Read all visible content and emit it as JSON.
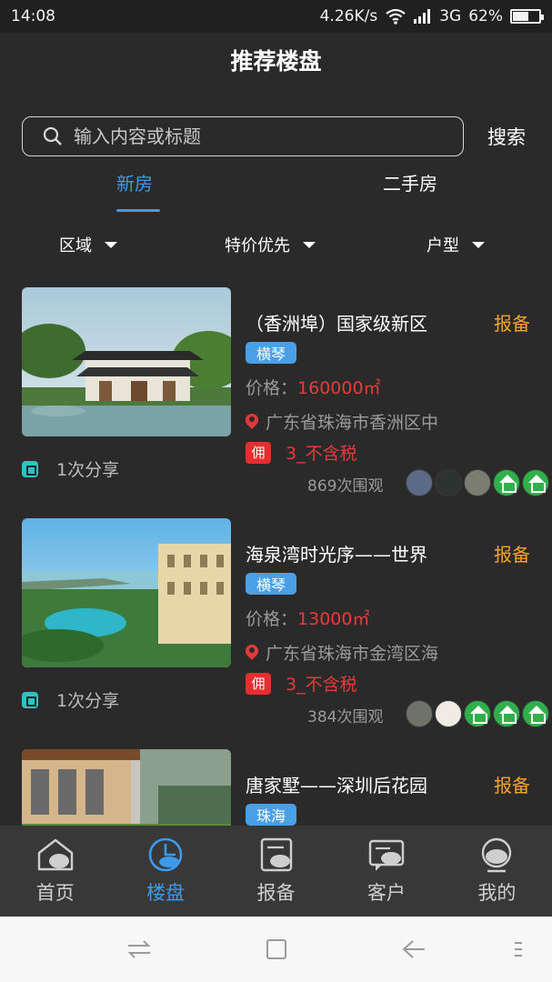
{
  "status_bar": {
    "time": "14:08",
    "speed": "4.26K/s",
    "network": "3G",
    "battery": "62%",
    "battery_level": 0.62
  },
  "header": {
    "title": "推荐楼盘"
  },
  "search": {
    "placeholder": "输入内容或标题",
    "button": "搜索"
  },
  "tabs": [
    {
      "label": "新房",
      "active": true
    },
    {
      "label": "二手房",
      "active": false
    }
  ],
  "filters": [
    {
      "label": "区域"
    },
    {
      "label": "特价优先"
    },
    {
      "label": "户型"
    }
  ],
  "listings": [
    {
      "title": "（香洲埠）国家级新区",
      "report": "报备",
      "region": "横琴",
      "price_label": "价格：",
      "price": "160000㎡",
      "address": "广东省珠海市香洲区中",
      "commission_badge": "佣",
      "commission": "3_不含税",
      "shares": "1次分享",
      "views": "869次围观"
    },
    {
      "title": "海泉湾时光序——世界",
      "report": "报备",
      "region": "横琴",
      "price_label": "价格：",
      "price": "13000㎡",
      "address": "广东省珠海市金湾区海",
      "commission_badge": "佣",
      "commission": "3_不含税",
      "shares": "1次分享",
      "views": "384次围观"
    },
    {
      "title": "唐家墅——深圳后花园",
      "report": "报备",
      "region": "珠海"
    }
  ],
  "bottom_nav": [
    {
      "label": "首页",
      "icon": "home-icon",
      "active": false
    },
    {
      "label": "楼盘",
      "icon": "building-icon",
      "active": true
    },
    {
      "label": "报备",
      "icon": "report-icon",
      "active": false
    },
    {
      "label": "客户",
      "icon": "client-icon",
      "active": false
    },
    {
      "label": "我的",
      "icon": "profile-icon",
      "active": false
    }
  ],
  "colors": {
    "accent": "#3d9bee",
    "report": "#f7a32b",
    "price": "#ea3b3b",
    "background": "#2a2a2a"
  }
}
